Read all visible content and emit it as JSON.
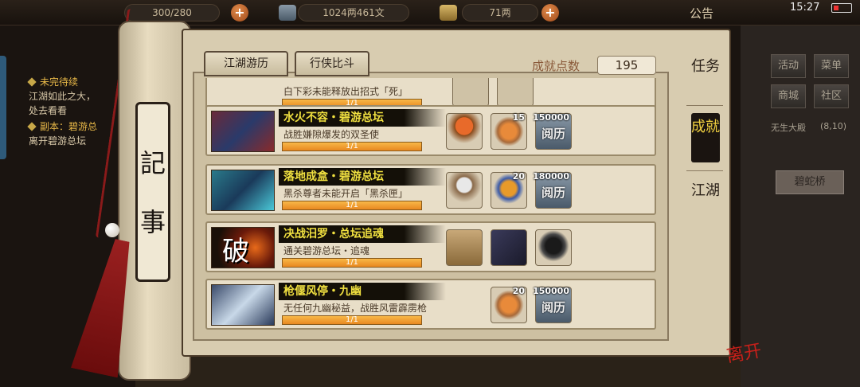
{
  "topbar": {
    "resource1": "300/280",
    "money": "1024两461文",
    "gold": "71两",
    "notice": "公告",
    "time": "15:27"
  },
  "quest_panel": {
    "line1": "未完待续",
    "line2": "江湖如此之大，",
    "line3": "处去看看",
    "line4": "副本：碧游总",
    "line5": "离开碧游总坛"
  },
  "side_menu": {
    "buttons": [
      "活动",
      "菜单",
      "商城",
      "社区"
    ],
    "location": "无生大殿",
    "coords": "(8,10)",
    "bridge": "碧蛇桥"
  },
  "scroll": {
    "char1": "記",
    "char2": "事"
  },
  "tabs": {
    "jianghu": "江湖游历",
    "xingxia": "行侠比斗"
  },
  "points": {
    "label": "成就点数",
    "value": "195"
  },
  "vertical_tabs": {
    "task": "任务",
    "achievement": "成就",
    "jianghu": "江湖"
  },
  "achievements": [
    {
      "title": "",
      "desc": "白下彩未能释放出招式「死」",
      "progress": "1/1",
      "progress_fraction": 1.0,
      "thumb_char": "",
      "rewards": []
    },
    {
      "title": "水火不容・碧游总坛",
      "desc": "战胜嫌隙爆发的双圣使",
      "progress": "1/1",
      "progress_fraction": 1.0,
      "thumb_char": "",
      "rewards": [
        {
          "icon": "orb-stand-icon",
          "count": "",
          "label": ""
        },
        {
          "icon": "fruit-plate-icon",
          "count": "15",
          "label": ""
        },
        {
          "icon": "book-icon",
          "count": "150000",
          "label": "阅历"
        }
      ]
    },
    {
      "title": "落地成盒・碧游总坛",
      "desc": "黑杀尊者未能开启「黑杀匣」",
      "progress": "1/1",
      "progress_fraction": 1.0,
      "thumb_char": "",
      "rewards": [
        {
          "icon": "orb-stand-icon",
          "count": "",
          "label": ""
        },
        {
          "icon": "orb-plate-icon",
          "count": "20",
          "label": ""
        },
        {
          "icon": "book-icon",
          "count": "180000",
          "label": "阅历"
        }
      ]
    },
    {
      "title": "决战汨罗・总坛追魂",
      "desc": "通关碧游总坛・追魂",
      "progress": "1/1",
      "progress_fraction": 1.0,
      "thumb_char": "破",
      "rewards": [
        {
          "icon": "manual-book-icon",
          "count": "",
          "label": ""
        },
        {
          "icon": "armor-icon",
          "count": "",
          "label": ""
        },
        {
          "icon": "hood-icon",
          "count": "",
          "label": ""
        }
      ]
    },
    {
      "title": "枪偃风停・九幽",
      "desc": "无任何九幽秘益，战胜风雷霹雳枪",
      "progress": "1/1",
      "progress_fraction": 1.0,
      "thumb_char": "",
      "rewards": [
        {
          "icon": "fruit-plate-icon",
          "count": "20",
          "label": ""
        },
        {
          "icon": "book-icon",
          "count": "150000",
          "label": "阅历"
        }
      ]
    }
  ],
  "leave_seal": "离开",
  "colors": {
    "title_bar": "#141008",
    "title_text": "#f0e040",
    "progress": "#f0a030",
    "seal": "#c8201a"
  }
}
